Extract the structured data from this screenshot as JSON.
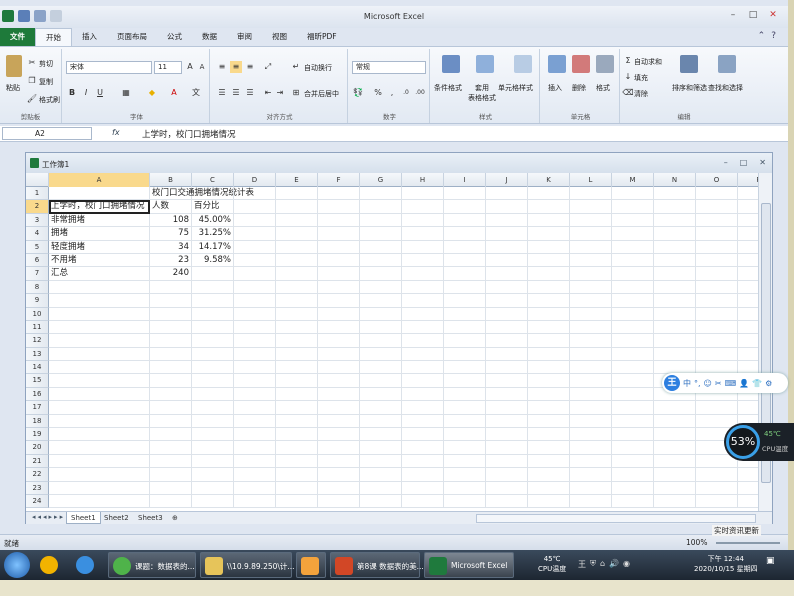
{
  "window": {
    "title": "Microsoft Excel",
    "controls": [
      "–",
      "□",
      "✕"
    ]
  },
  "ribbon_tabs": [
    "文件",
    "开始",
    "插入",
    "页面布局",
    "公式",
    "数据",
    "审阅",
    "视图",
    "福昕PDF"
  ],
  "clipboard": {
    "paste": "粘贴",
    "cut": "剪切",
    "copy": "复制",
    "format_painter": "格式刷",
    "label": "剪贴板"
  },
  "font": {
    "name": "宋体",
    "size": "11",
    "label": "字体"
  },
  "alignment": {
    "wrap": "自动换行",
    "merge": "合并后居中",
    "label": "对齐方式"
  },
  "number": {
    "format": "常规",
    "label": "数字"
  },
  "styles": {
    "conditional": "条件格式",
    "table": "套用\n表格格式",
    "cell_styles": "单元格样式",
    "label": "样式"
  },
  "cells": {
    "insert": "插入",
    "delete": "删除",
    "format": "格式",
    "label": "单元格"
  },
  "editing": {
    "autosum": "自动求和",
    "fill": "填充",
    "clear": "清除",
    "sort": "排序和筛选",
    "find": "查找和选择",
    "label": "编辑"
  },
  "formula_bar": {
    "name_box": "A2",
    "fx": "fx",
    "content": "上学时，校门口拥堵情况"
  },
  "workbook": {
    "name": "工作簿1"
  },
  "columns": [
    "A",
    "B",
    "C",
    "D",
    "E",
    "F",
    "G",
    "H",
    "I",
    "J",
    "K",
    "L",
    "M",
    "N",
    "O",
    "P"
  ],
  "rows": [
    {
      "n": "1",
      "a": "",
      "b": "校门口交通拥堵情况统计表",
      "c": ""
    },
    {
      "n": "2",
      "a": "上学时，校门口拥堵情况",
      "b": "人数",
      "c": "百分比"
    },
    {
      "n": "3",
      "a": "非常拥堵",
      "b": "108",
      "c": "45.00%"
    },
    {
      "n": "4",
      "a": "拥堵",
      "b": "75",
      "c": "31.25%"
    },
    {
      "n": "5",
      "a": "轻度拥堵",
      "b": "34",
      "c": "14.17%"
    },
    {
      "n": "6",
      "a": "不用堵",
      "b": "23",
      "c": "9.58%"
    },
    {
      "n": "7",
      "a": "汇总",
      "b": "240",
      "c": ""
    },
    {
      "n": "8"
    },
    {
      "n": "9"
    },
    {
      "n": "10"
    },
    {
      "n": "11"
    },
    {
      "n": "12"
    },
    {
      "n": "13"
    },
    {
      "n": "14"
    },
    {
      "n": "15"
    },
    {
      "n": "16"
    },
    {
      "n": "17"
    },
    {
      "n": "18"
    },
    {
      "n": "19"
    },
    {
      "n": "20"
    },
    {
      "n": "21"
    },
    {
      "n": "22"
    },
    {
      "n": "23"
    },
    {
      "n": "24"
    }
  ],
  "sheets": [
    "Sheet1",
    "Sheet2",
    "Sheet3"
  ],
  "status": {
    "ready": "就绪",
    "zoom": "100%"
  },
  "ime_bar": {
    "logo": "王",
    "lang": "中"
  },
  "cpu_widget": {
    "percent": "53%",
    "temp": "45℃",
    "label": "CPU温度"
  },
  "news_popup": "实时资讯更新",
  "taskbar": {
    "items": [
      "课题：数据表的...",
      "\\\\10.9.89.250\\计...",
      "",
      "第8课 数据表的美...",
      "Microsoft Excel"
    ],
    "tray_cpu": [
      "45℃",
      "CPU温度"
    ],
    "clock": [
      "下午 12:44",
      "2020/10/15 星期四"
    ]
  },
  "colors": {
    "excel_green": "#1e7a3a",
    "selection": "#f9d98c",
    "ribbon_bg": "#e2e9f3"
  }
}
